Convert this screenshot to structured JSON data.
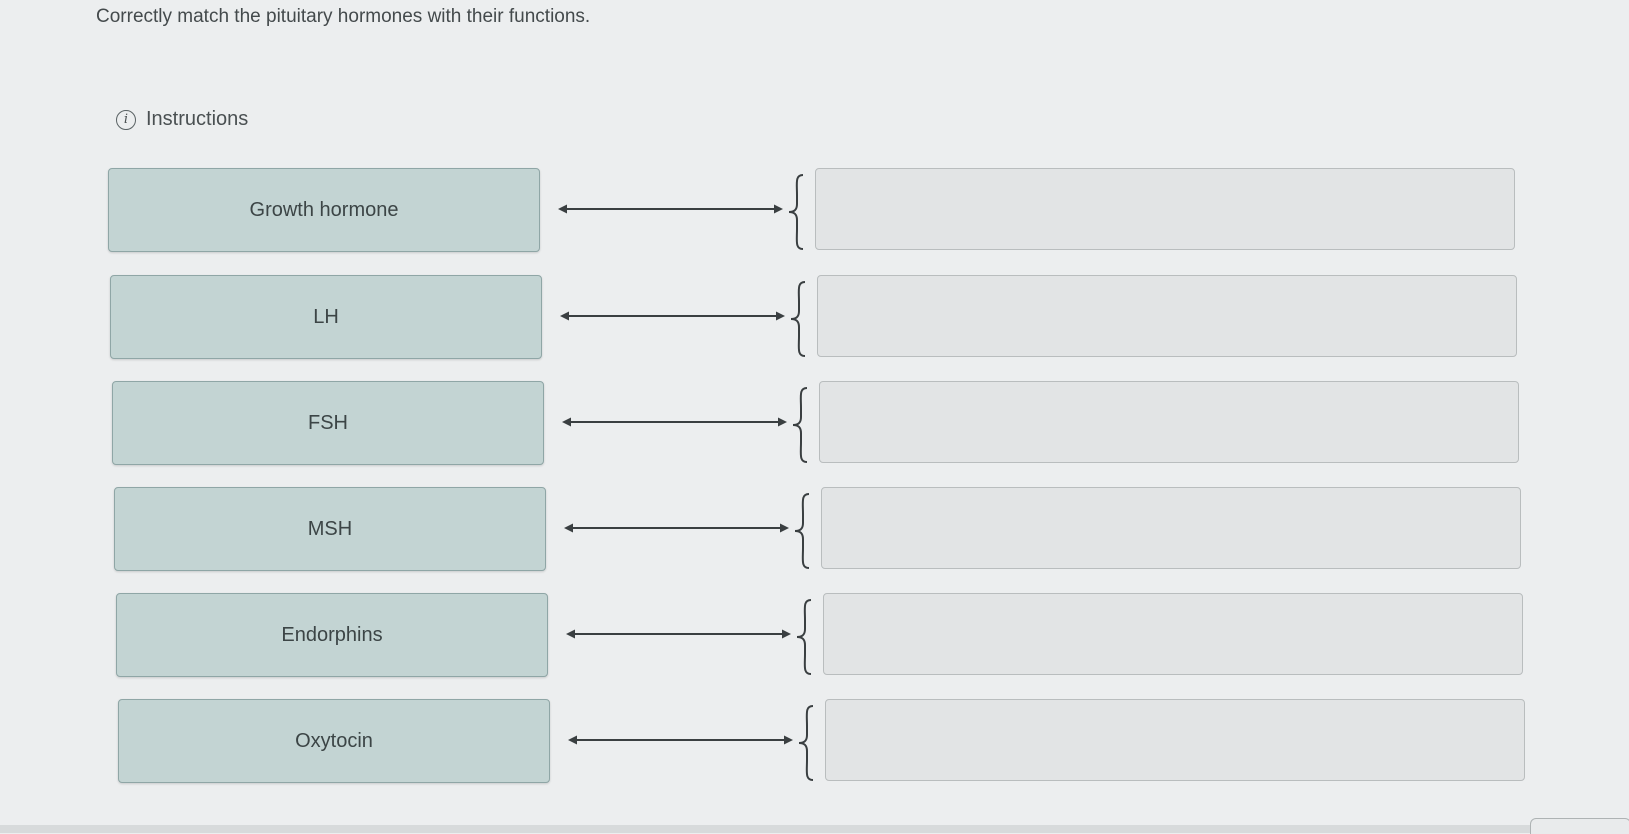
{
  "prompt": "Correctly match the pituitary hormones with their functions.",
  "instructions": {
    "icon": "info-icon",
    "label": "Instructions"
  },
  "hormones": [
    {
      "label": "Growth hormone",
      "match": ""
    },
    {
      "label": "LH",
      "match": ""
    },
    {
      "label": "FSH",
      "match": ""
    },
    {
      "label": "MSH",
      "match": ""
    },
    {
      "label": "Endorphins",
      "match": ""
    },
    {
      "label": "Oxytocin",
      "match": ""
    }
  ],
  "colors": {
    "card_bg": "#c3d4d3",
    "card_border": "#8fa6a6",
    "dropzone_bg": "#e2e4e5",
    "page_bg": "#eceeef"
  }
}
